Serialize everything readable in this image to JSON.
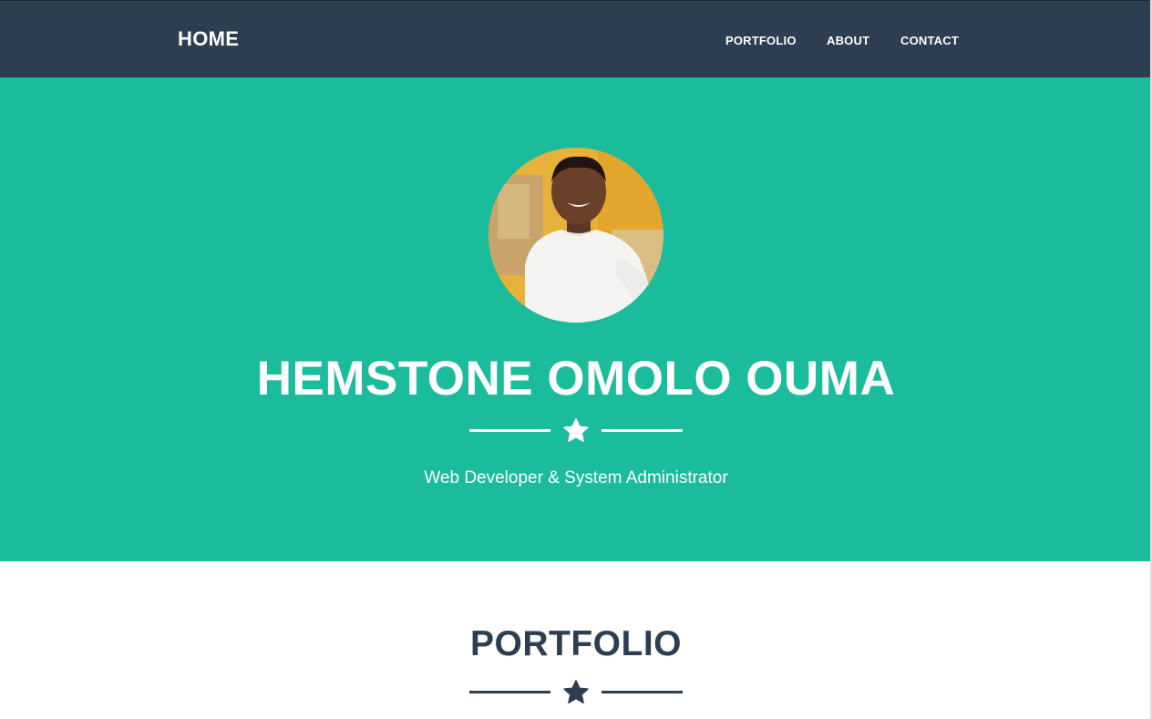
{
  "nav": {
    "brand": "HOME",
    "links": [
      {
        "label": "PORTFOLIO"
      },
      {
        "label": "ABOUT"
      },
      {
        "label": "CONTACT"
      }
    ],
    "background": "#2c3e50"
  },
  "hero": {
    "name": "HEMSTONE OMOLO OUMA",
    "subtitle": "Web Developer & System Administrator",
    "divider_icon": "star-icon",
    "background": "#1abc9c"
  },
  "portfolio": {
    "heading": "PORTFOLIO",
    "divider_icon": "star-icon",
    "color": "#2c3e50"
  }
}
